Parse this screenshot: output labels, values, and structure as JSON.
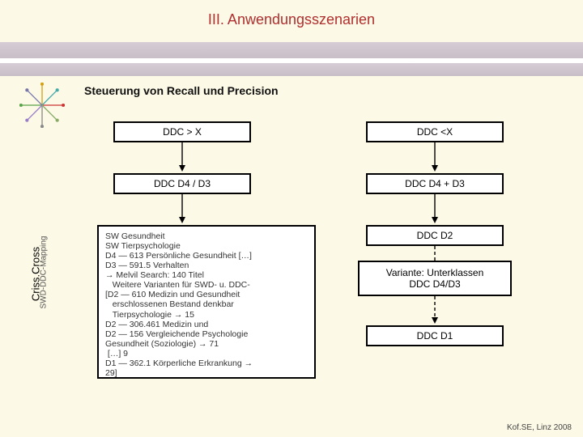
{
  "header": {
    "title": "III. Anwendungsszenarien"
  },
  "subtitle": "Steuerung von Recall und Precision",
  "sidebar": {
    "main": "Criss.Cross",
    "sub": "SWD-DDC-Mapping"
  },
  "left_col": {
    "top": "DDC > X",
    "mid": "DDC D4 / D3",
    "text": "SW Gesundheit\nSW Tierpsychologie\nD4 — 613 Persönliche Gesundheit […]\nD3 — 591.5 Verhalten\n→ Melvil Search: 140 Titel\n   Weitere Varianten für SWD- u. DDC-\n[D2 — 610 Medizin und Gesundheit\n   erschlossenen Bestand denkbar\n   Tierpsychologie → 15\nD2 — 306.461 Medizin und\nD2 — 156 Vergleichende Psychologie\nGesundheit (Soziologie) → 71\n […] 9\nD1 — 362.1 Körperliche Erkrankung →\n29]"
  },
  "right_col": {
    "top": "DDC <X",
    "mid": "DDC D4 + D3",
    "box1": "DDC D2",
    "box2_line1": "Variante: Unterklassen",
    "box2_line2": "DDC D4/D3",
    "box3": "DDC D1"
  },
  "footer": "Kof.SE, Linz 2008"
}
